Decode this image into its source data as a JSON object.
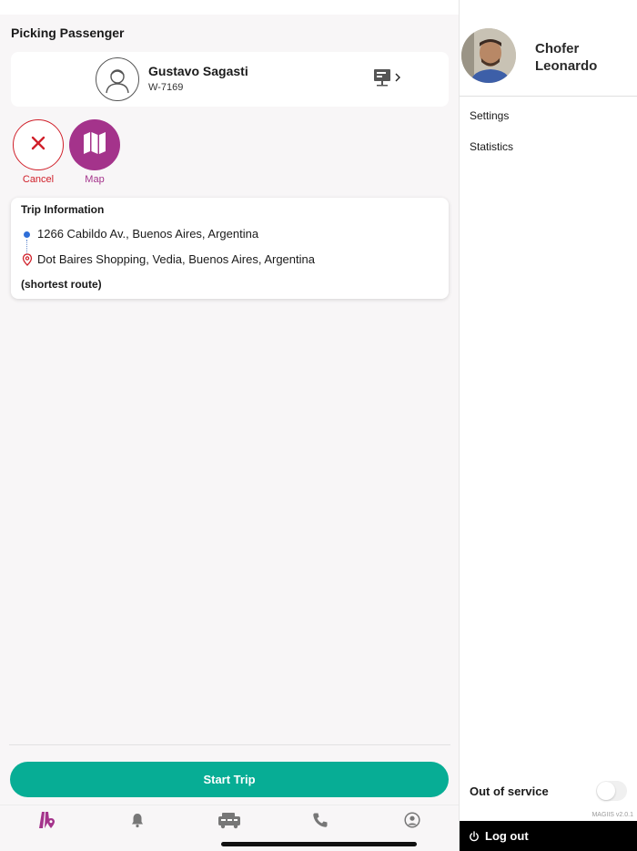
{
  "header": {
    "title": "Picking Passenger"
  },
  "passenger": {
    "name": "Gustavo Sagasti",
    "plate": "W-7169"
  },
  "actions": {
    "cancel_label": "Cancel",
    "map_label": "Map"
  },
  "trip": {
    "title": "Trip Information",
    "origin": "1266 Cabildo Av., Buenos Aires, Argentina",
    "destination": "Dot Baires Shopping, Vedia, Buenos Aires, Argentina",
    "route_note": "(shortest route)"
  },
  "start_trip_label": "Start Trip",
  "tabs": [
    {
      "icon": "trips-icon",
      "active": true
    },
    {
      "icon": "bell-icon",
      "active": false
    },
    {
      "icon": "taxi-icon",
      "active": false
    },
    {
      "icon": "phone-icon",
      "active": false
    },
    {
      "icon": "profile-icon",
      "active": false
    }
  ],
  "drawer": {
    "driver_first": "Chofer",
    "driver_last": "Leonardo",
    "menu": [
      "Settings",
      "Statistics"
    ],
    "out_of_service_label": "Out of service",
    "out_of_service_on": false,
    "version": "MAGIIS v2.0.1",
    "logout_label": "Log out"
  },
  "colors": {
    "accent": "#a4338b",
    "primary": "#07ad95",
    "danger": "#d0202a"
  }
}
